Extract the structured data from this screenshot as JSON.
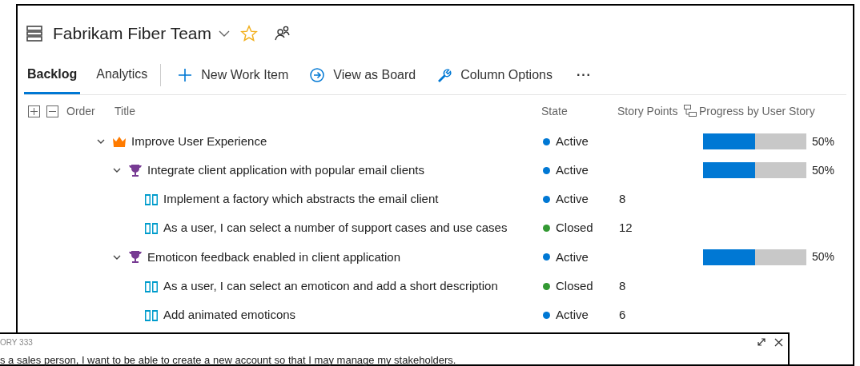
{
  "header": {
    "team": "Fabrikam Fiber Team",
    "favorite": false
  },
  "tabs": [
    {
      "label": "Backlog",
      "selected": true
    },
    {
      "label": "Analytics",
      "selected": false
    }
  ],
  "toolbar": [
    {
      "kind": "add",
      "label": "New Work Item"
    },
    {
      "kind": "board",
      "label": "View as Board"
    },
    {
      "kind": "wrench",
      "label": "Column Options"
    },
    {
      "kind": "more",
      "label": "···"
    }
  ],
  "columns": {
    "order": "Order",
    "title": "Title",
    "state": "State",
    "story_points": "Story Points",
    "progress": "Progress by User Story"
  },
  "rows": [
    {
      "kind": "epic",
      "title": "Improve User Experience",
      "expanded": true,
      "state": "Active",
      "color": "#0078d4",
      "level": 0.5,
      "progress": "50%",
      "children": [
        {
          "kind": "feature",
          "title": "Integrate client application with popular email clients",
          "expanded": true,
          "state": "Active",
          "color": "#0078d4",
          "level": 0.5,
          "progress": "50%",
          "children": [
            {
              "kind": "story",
              "title": "Implement a factory which abstracts the email client",
              "state": "Active",
              "color": "#0078d4",
              "points": "8"
            },
            {
              "kind": "story",
              "title": "As a user, I can select a number of support cases and use cases",
              "state": "Closed",
              "color": "#339933",
              "points": "12"
            }
          ]
        },
        {
          "kind": "feature",
          "title": "Emoticon feedback enabled in client application",
          "expanded": true,
          "state": "Active",
          "color": "#0078d4",
          "level": 0.5,
          "progress": "50%",
          "children": [
            {
              "kind": "story",
              "title": "As a user, I can select an emoticon and add a short description",
              "state": "Closed",
              "color": "#339933",
              "points": "8"
            },
            {
              "kind": "story",
              "title": "Add animated emoticons",
              "state": "Active",
              "color": "#0078d4",
              "points": "6"
            }
          ]
        }
      ]
    }
  ],
  "popup": {
    "label": "ORY 333",
    "text": "s a sales person, I want to be able to create a new account so that I may manage my stakeholders."
  }
}
